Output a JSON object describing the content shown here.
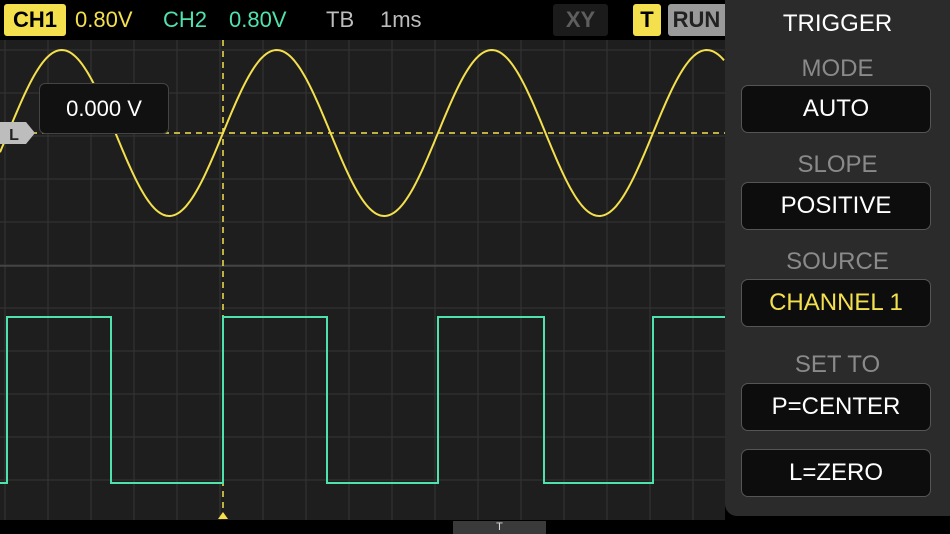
{
  "topbar": {
    "ch1_label": "CH1",
    "ch1_scale": "0.80V",
    "ch2_label": "CH2",
    "ch2_scale": "0.80V",
    "tb_label": "TB",
    "tb_value": "1ms",
    "xy_label": "XY",
    "trigger_label": "T",
    "run_label": "RUN"
  },
  "screen": {
    "level_marker": "L",
    "level_readout": "0.000 V",
    "trigger_position_marker": "T"
  },
  "trigger_panel": {
    "title": "TRIGGER",
    "mode_label": "MODE",
    "mode_value": "AUTO",
    "slope_label": "SLOPE",
    "slope_value": "POSITIVE",
    "source_label": "SOURCE",
    "source_value": "CHANNEL 1",
    "set_to_label": "SET TO",
    "set_center_button": "P=CENTER",
    "set_zero_button": "L=ZERO"
  },
  "colors": {
    "ch1": "#f4e04d",
    "ch2": "#4fe2ad",
    "background": "#1e1e1e",
    "grid": "#3a3a3a",
    "panel": "#2b2b2b",
    "badge_bg": "#f4e04d",
    "button_bg": "#0d0d0d"
  }
}
